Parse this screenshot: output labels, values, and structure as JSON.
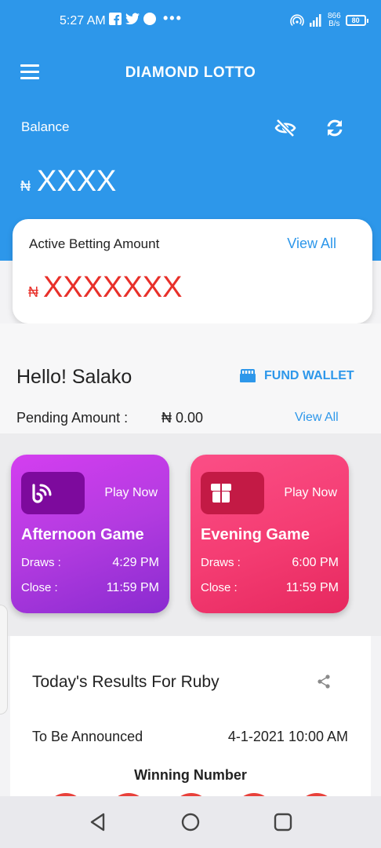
{
  "status_bar": {
    "time": "5:27 AM",
    "dots": "•••",
    "speed_value": "866",
    "speed_unit": "B/s",
    "battery": "80"
  },
  "header": {
    "title": "DIAMOND LOTTO",
    "balance_label": "Balance",
    "currency_symbol": "₦",
    "balance_value": "XXXX"
  },
  "bet_card": {
    "label": "Active Betting Amount",
    "view_all": "View All",
    "currency_symbol": "₦",
    "amount": "XXXXXXX"
  },
  "user": {
    "greeting": "Hello! Salako",
    "fund_wallet": "FUND WALLET",
    "pending_label": "Pending Amount :",
    "pending_value": "₦ 0.00",
    "pending_view_all": "View All"
  },
  "games": [
    {
      "play_label": "Play Now",
      "name": "Afternoon Game",
      "draws_label": "Draws :",
      "draws_time": "4:29 PM",
      "close_label": "Close :",
      "close_time": "11:59 PM"
    },
    {
      "play_label": "Play Now",
      "name": "Evening Game",
      "draws_label": "Draws :",
      "draws_time": "6:00 PM",
      "close_label": "Close :",
      "close_time": "11:59 PM"
    }
  ],
  "results": {
    "title": "Today's Results For Ruby",
    "status": "To Be Announced",
    "datetime": "4-1-2021 10:00 AM",
    "winning_label": "Winning Number"
  },
  "colors": {
    "primary": "#2d97ea",
    "accent_red": "#e8302a",
    "afternoon_card": "#b33be0",
    "evening_card": "#f43c72"
  },
  "icons": {
    "menu": "hamburger-icon",
    "eye": "eye-off-icon",
    "refresh": "refresh-icon",
    "wallet": "wallet-icon",
    "share": "share-icon",
    "afternoon": "signal-icon",
    "evening": "box-icon"
  }
}
